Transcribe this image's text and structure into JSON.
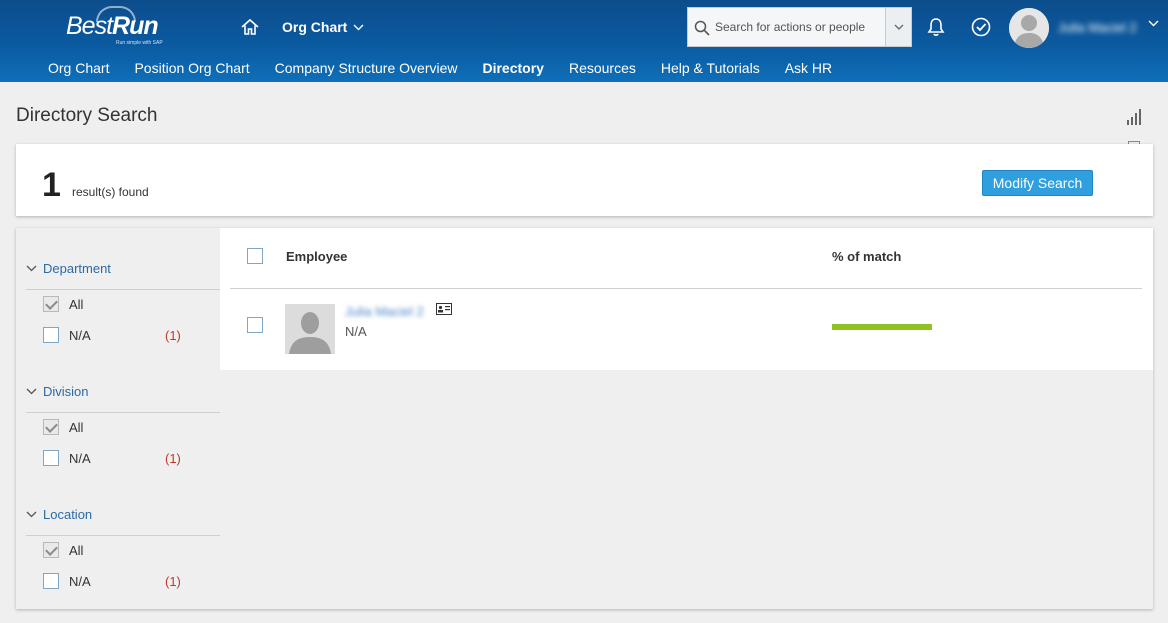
{
  "header": {
    "logo_main": "Best",
    "logo_bold": "Run",
    "logo_tagline": "Run simple with SAP",
    "app_menu_label": "Org Chart",
    "search_placeholder": "Search for actions or people",
    "user_name": "Julia Maciel 2"
  },
  "nav": {
    "items": [
      {
        "label": "Org Chart",
        "active": false
      },
      {
        "label": "Position Org Chart",
        "active": false
      },
      {
        "label": "Company Structure Overview",
        "active": false
      },
      {
        "label": "Directory",
        "active": true
      },
      {
        "label": "Resources",
        "active": false
      },
      {
        "label": "Help & Tutorials",
        "active": false
      },
      {
        "label": "Ask HR",
        "active": false
      }
    ]
  },
  "page": {
    "title": "Directory Search"
  },
  "results": {
    "count": "1",
    "label": "result(s) found",
    "modify_button": "Modify Search"
  },
  "facets": [
    {
      "title": "Department",
      "options": [
        {
          "label": "All",
          "checked": true,
          "count": ""
        },
        {
          "label": "N/A",
          "checked": false,
          "count": "(1)"
        }
      ]
    },
    {
      "title": "Division",
      "options": [
        {
          "label": "All",
          "checked": true,
          "count": ""
        },
        {
          "label": "N/A",
          "checked": false,
          "count": "(1)"
        }
      ]
    },
    {
      "title": "Location",
      "options": [
        {
          "label": "All",
          "checked": true,
          "count": ""
        },
        {
          "label": "N/A",
          "checked": false,
          "count": "(1)"
        }
      ]
    }
  ],
  "table": {
    "col_employee": "Employee",
    "col_match": "% of match",
    "rows": [
      {
        "name": "Julia Maciel 2",
        "subtitle": "N/A",
        "match_fraction": 1.0
      }
    ]
  },
  "colors": {
    "header_blue": "#0b5aa0",
    "accent_button": "#2f9fde",
    "match_bar": "#8fc31f",
    "facet_title": "#2a6aa6",
    "facet_count": "#c0392b"
  }
}
